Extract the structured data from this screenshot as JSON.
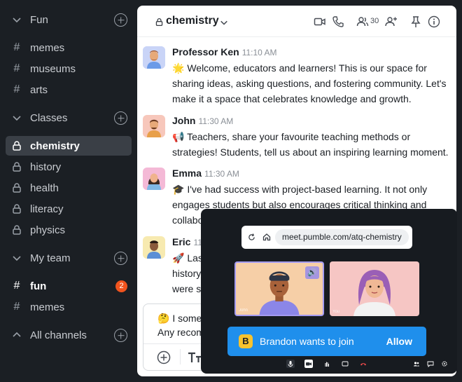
{
  "sidebar": {
    "sections": [
      {
        "label": "Fun",
        "items": [
          {
            "icon": "hash-icon",
            "label": "memes"
          },
          {
            "icon": "hash-icon",
            "label": "museums"
          },
          {
            "icon": "hash-icon",
            "label": "arts"
          }
        ]
      },
      {
        "label": "Classes",
        "items": [
          {
            "icon": "lock-icon",
            "label": "chemistry"
          },
          {
            "icon": "lock-icon",
            "label": "history"
          },
          {
            "icon": "lock-icon",
            "label": "health"
          },
          {
            "icon": "lock-icon",
            "label": "literacy"
          },
          {
            "icon": "lock-icon",
            "label": "physics"
          }
        ]
      },
      {
        "label": "My team",
        "items": [
          {
            "icon": "hash-icon",
            "label": "fun",
            "badge": "2"
          },
          {
            "icon": "hash-icon",
            "label": "memes"
          }
        ]
      },
      {
        "label": "All channels",
        "items": []
      }
    ]
  },
  "channel": {
    "title": "chemistry",
    "member_count": "30"
  },
  "messages": [
    {
      "author": "Professor Ken",
      "time": "11:10 AM",
      "text": "🌟 Welcome, educators and learners! This is our space for sharing ideas, asking questions, and fostering community. Let's make it a space that celebrates knowledge and growth."
    },
    {
      "author": "John",
      "time": "11:30 AM",
      "text": "📢 Teachers, share your favourite teaching methods or strategies! Students, tell us about an inspiring learning moment."
    },
    {
      "author": "Emma",
      "time": "11:30 AM",
      "text": "🎓 I've had success with project-based learning. It not only engages students but also encourages critical thinking and collabo"
    },
    {
      "author": "Eric",
      "time": "11",
      "text": "🚀 Las",
      "line2": "history",
      "line3": "were s"
    }
  ],
  "composer": {
    "line1": "🤔 I some",
    "line2": "Any recom"
  },
  "call": {
    "url": "meet.pumble.com/atq-chemistry",
    "tile1_name": "John",
    "tile2_name": "You",
    "join_text": "Brandon wants to join",
    "join_initial": "B",
    "allow_label": "Allow"
  },
  "colors": {
    "sidebar_bg": "#1b1f24",
    "accent": "#1f8fec",
    "badge": "#f0541e"
  }
}
